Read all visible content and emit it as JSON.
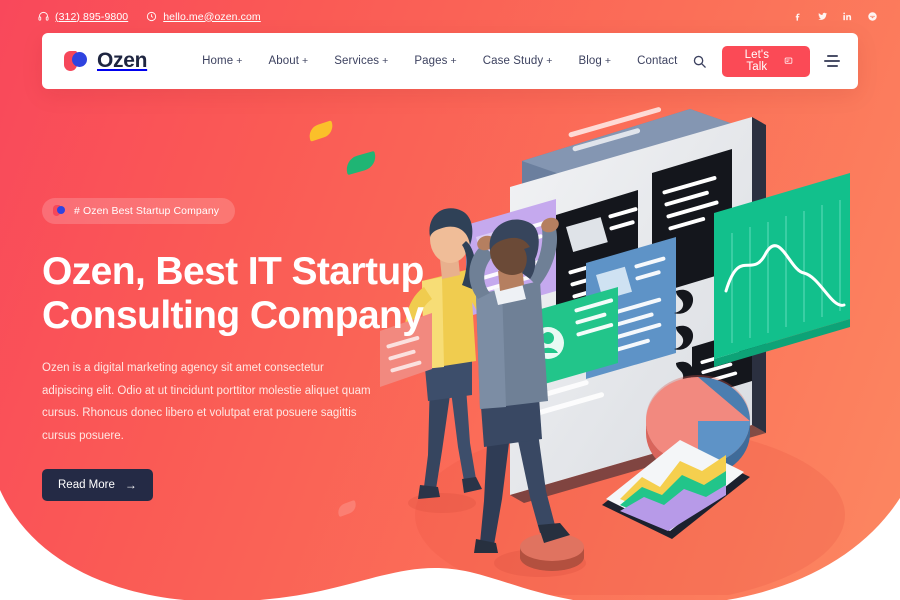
{
  "topbar": {
    "phone": "(312) 895-9800",
    "phone_icon": "headphone-icon",
    "email": "hello.me@ozen.com",
    "email_icon": "globe-icon",
    "socials": [
      {
        "name": "facebook-icon",
        "label": "f"
      },
      {
        "name": "twitter-icon",
        "label": "t"
      },
      {
        "name": "linkedin-icon",
        "label": "in"
      },
      {
        "name": "dribbble-icon",
        "label": "d"
      }
    ]
  },
  "header": {
    "brand": "Ozen",
    "nav": [
      {
        "label": "Home",
        "has_children": true
      },
      {
        "label": "About",
        "has_children": true
      },
      {
        "label": "Services",
        "has_children": true
      },
      {
        "label": "Pages",
        "has_children": true
      },
      {
        "label": "Case Study",
        "has_children": true
      },
      {
        "label": "Blog",
        "has_children": true
      },
      {
        "label": "Contact",
        "has_children": false
      }
    ],
    "search_icon": "search-icon",
    "cta_label": "Let's Talk",
    "cta_icon": "chat-icon",
    "menu_icon": "hamburger-icon"
  },
  "hero": {
    "badge": "# Ozen Best Startup Company",
    "title": "Ozen, Best IT Startup Consulting Company",
    "paragraph": "Ozen is a digital marketing agency sit amet consectetur adipiscing elit. Odio at ut tincidunt porttitor molestie aliquet quam cursus. Rhoncus donec libero et volutpat erat posuere sagittis cursus posuere.",
    "button_label": "Read More",
    "button_arrow": "→"
  },
  "colors": {
    "gradient_start": "#f9485b",
    "gradient_end": "#fc8761",
    "accent_red": "#fb4a56",
    "accent_blue": "#2f43e0",
    "dark_navy": "#242a45",
    "nav_text": "#3d4260",
    "illustration_green": "#22c58a",
    "illustration_purple": "#c5a9ee",
    "illustration_blue": "#5e93c7",
    "illustration_yellow": "#f5cf4e",
    "leaf_yellow": "#fbc02a",
    "leaf_green": "#1fb574",
    "dots_purple": "#a348d8"
  }
}
